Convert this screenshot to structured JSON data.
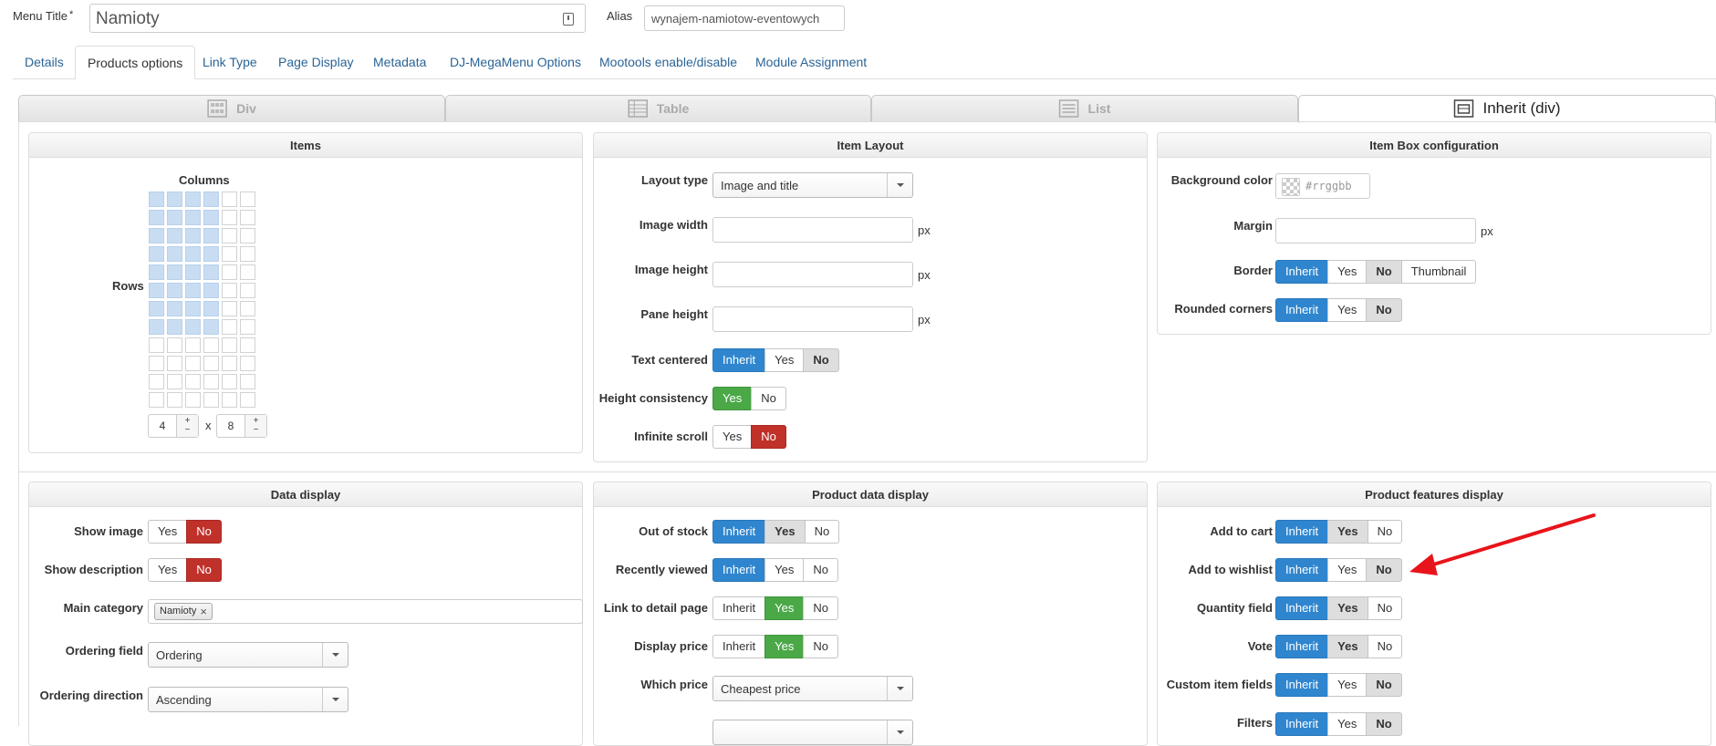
{
  "header": {
    "menu_title_label": "Menu Title",
    "required_mark": "*",
    "menu_title_value": "Namioty",
    "alias_label": "Alias",
    "alias_value": "wynajem-namiotow-eventowych"
  },
  "tabs": [
    {
      "label": "Details"
    },
    {
      "label": "Products options",
      "active": true
    },
    {
      "label": "Link Type"
    },
    {
      "label": "Page Display"
    },
    {
      "label": "Metadata"
    },
    {
      "label": "DJ-MegaMenu Options"
    },
    {
      "label": "Mootools enable/disable"
    },
    {
      "label": "Module Assignment"
    }
  ],
  "layout_tabs": [
    {
      "label": "Div",
      "icon": "grid-layout-icon"
    },
    {
      "label": "Table",
      "icon": "table-layout-icon"
    },
    {
      "label": "List",
      "icon": "list-layout-icon"
    },
    {
      "label": "Inherit (div)",
      "icon": "inherit-layout-icon",
      "active": true
    }
  ],
  "items_panel": {
    "title": "Items",
    "columns_label": "Columns",
    "rows_label": "Rows",
    "grid": {
      "total_cols": 6,
      "total_rows": 12,
      "selected_cols": 4,
      "selected_rows": 8
    },
    "columns_value": "4",
    "times": "x",
    "rows_value": "8",
    "plus": "+",
    "minus": "−"
  },
  "item_layout": {
    "title": "Item Layout",
    "layout_type_label": "Layout type",
    "layout_type_value": "Image and title",
    "image_width_label": "Image width",
    "image_height_label": "Image height",
    "pane_height_label": "Pane height",
    "unit": "px",
    "text_centered_label": "Text centered",
    "height_consistency_label": "Height consistency",
    "infinite_scroll_label": "Infinite scroll"
  },
  "item_box": {
    "title": "Item Box configuration",
    "background_color_label": "Background color",
    "background_color_placeholder": "#rrggbb",
    "margin_label": "Margin",
    "unit": "px",
    "border_label": "Border",
    "rounded_corners_label": "Rounded corners"
  },
  "data_display": {
    "title": "Data display",
    "show_image_label": "Show image",
    "show_description_label": "Show description",
    "main_category_label": "Main category",
    "main_category_tag": "Namioty",
    "tag_remove": "×",
    "ordering_field_label": "Ordering field",
    "ordering_field_value": "Ordering",
    "ordering_direction_label": "Ordering direction",
    "ordering_direction_value": "Ascending"
  },
  "product_data": {
    "title": "Product data display",
    "out_of_stock_label": "Out of stock",
    "recently_viewed_label": "Recently viewed",
    "link_detail_label": "Link to detail page",
    "display_price_label": "Display price",
    "which_price_label": "Which price",
    "which_price_value": "Cheapest price"
  },
  "product_features": {
    "title": "Product features display",
    "add_to_cart_label": "Add to cart",
    "add_to_wishlist_label": "Add to wishlist",
    "quantity_field_label": "Quantity field",
    "vote_label": "Vote",
    "custom_item_fields_label": "Custom item fields",
    "filters_label": "Filters"
  },
  "options": {
    "inherit": "Inherit",
    "yes": "Yes",
    "no": "No",
    "thumbnail": "Thumbnail"
  },
  "colors": {
    "primary_blue": "#2f86cf",
    "danger_red": "#c0312a",
    "success_green": "#4aa847",
    "link_blue": "#2a6496",
    "annotation_arrow": "#e8141b"
  }
}
